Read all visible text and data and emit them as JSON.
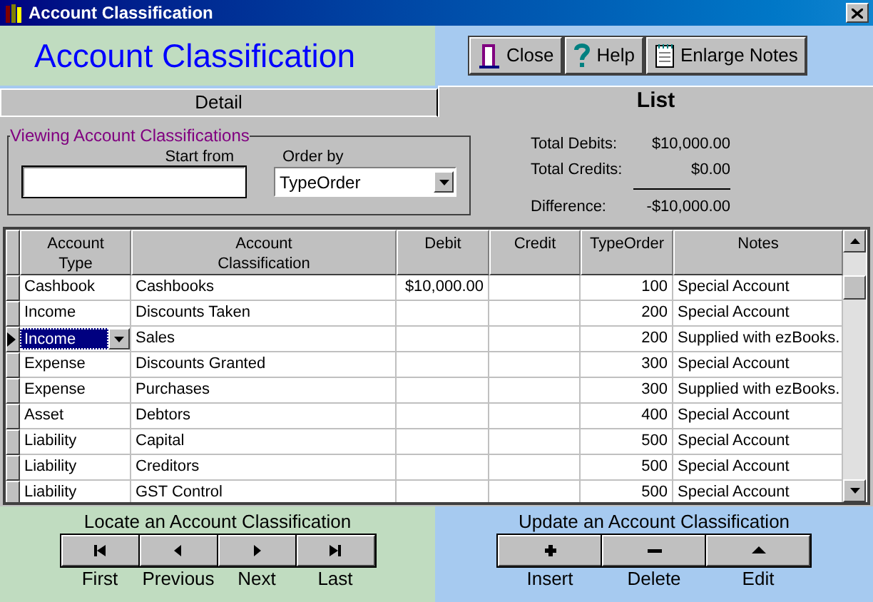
{
  "window": {
    "title": "Account Classification"
  },
  "header": {
    "title": "Account Classification",
    "buttons": [
      {
        "kind": "close",
        "label": "Close"
      },
      {
        "kind": "help",
        "label": "Help"
      },
      {
        "kind": "notes",
        "label": "Enlarge Notes"
      }
    ]
  },
  "tabs": [
    {
      "label": "Detail",
      "selected": false
    },
    {
      "label": "List",
      "selected": true
    }
  ],
  "filter": {
    "legend": "Viewing Account Classifications",
    "start_from": {
      "label": "Start from"
    },
    "order_by": {
      "label": "Order by",
      "value": "TypeOrder"
    }
  },
  "totals": [
    {
      "label": "Total Debits:",
      "value": "$10,000.00"
    },
    {
      "label": "Total Credits:",
      "value": "$0.00"
    },
    {
      "label": "Difference:",
      "value": "-$10,000.00"
    }
  ],
  "table": {
    "columns": [
      {
        "label": "Account Type"
      },
      {
        "label": "Account Classification"
      },
      {
        "label": "Debit"
      },
      {
        "label": "Credit"
      },
      {
        "label": "TypeOrder"
      },
      {
        "label": "Notes"
      }
    ],
    "rows": [
      {
        "selected": false,
        "cells": [
          "Cashbook",
          "Cashbooks",
          "$10,000.00",
          "",
          "100",
          "Special Account"
        ]
      },
      {
        "selected": false,
        "cells": [
          "Income",
          "Discounts Taken",
          "",
          "",
          "200",
          "Special Account"
        ]
      },
      {
        "selected": true,
        "cells": [
          "Income",
          "Sales",
          "",
          "",
          "200",
          "Supplied with ezBooks."
        ]
      },
      {
        "selected": false,
        "cells": [
          "Expense",
          "Discounts Granted",
          "",
          "",
          "300",
          "Special Account"
        ]
      },
      {
        "selected": false,
        "cells": [
          "Expense",
          "Purchases",
          "",
          "",
          "300",
          "Supplied with ezBooks."
        ]
      },
      {
        "selected": false,
        "cells": [
          "Asset",
          "Debtors",
          "",
          "",
          "400",
          "Special Account"
        ]
      },
      {
        "selected": false,
        "cells": [
          "Liability",
          "Capital",
          "",
          "",
          "500",
          "Special Account"
        ]
      },
      {
        "selected": false,
        "cells": [
          "Liability",
          "Creditors",
          "",
          "",
          "500",
          "Special Account"
        ]
      },
      {
        "selected": false,
        "cells": [
          "Liability",
          "GST Control",
          "",
          "",
          "500",
          "Special Account"
        ]
      }
    ]
  },
  "locate": {
    "title": "Locate an Account Classification",
    "buttons": [
      {
        "kind": "first",
        "label": "First"
      },
      {
        "kind": "previous",
        "label": "Previous"
      },
      {
        "kind": "next",
        "label": "Next"
      },
      {
        "kind": "last",
        "label": "Last"
      }
    ]
  },
  "update": {
    "title": "Update an Account Classification",
    "buttons": [
      {
        "kind": "insert",
        "label": "Insert"
      },
      {
        "kind": "delete",
        "label": "Delete"
      },
      {
        "kind": "edit",
        "label": "Edit"
      }
    ]
  }
}
